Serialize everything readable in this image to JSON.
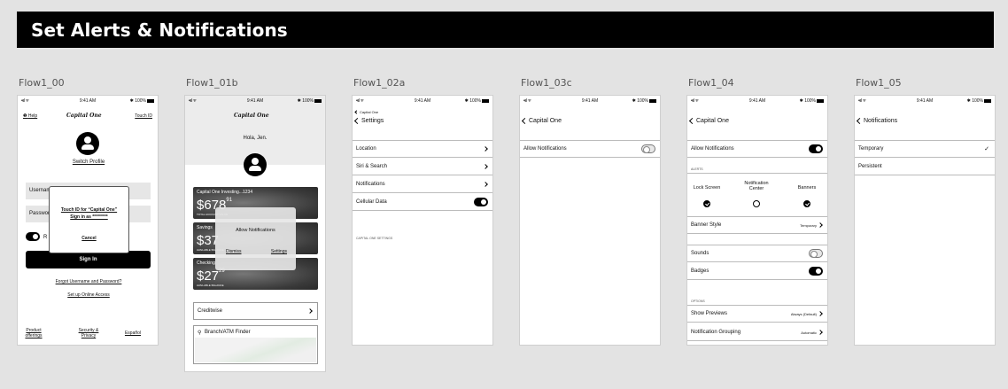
{
  "page_title": "Set Alerts & Notifications",
  "status_bar": {
    "signal": "•ııl ᯤ",
    "time": "9:41 AM",
    "battery": "✱ 100%"
  },
  "flow_00": {
    "label": "Flow1_00",
    "help": "Help",
    "logo": "Capital One",
    "touch_id": "Touch ID",
    "switch_profile": "Switch Profile",
    "username_placeholder": "Username",
    "password_placeholder": "Password",
    "remember": "R",
    "dialog_line1": "Touch ID for “Capital One”",
    "dialog_line2": "Sign in as *********",
    "dialog_cancel": "Cancel",
    "sign_in": "Sign In",
    "forgot": "Forgot Username and Password?",
    "setup": "Set up Online Access",
    "footer": [
      "Product offerings",
      "Security & Privacy",
      "Español"
    ]
  },
  "flow_01b": {
    "label": "Flow1_01b",
    "logo": "Capital One",
    "greeting": "Hola, Jen.",
    "cards": [
      {
        "title": "Capital One Investing...1234",
        "dollars": "678",
        "cents": "91",
        "sub": "TOTAL ACCOUNT VALUE"
      },
      {
        "title": "Savings",
        "dollars": "37",
        "cents": "",
        "sub": "AVAILABLE BALANCE"
      },
      {
        "title": "Checking",
        "dollars": "27",
        "cents": "29",
        "sub": "AVAILABLE BALANCE"
      }
    ],
    "overlay_title": "Allow Notifications",
    "overlay_dismiss": "Dismiss",
    "overlay_settings": "Settings",
    "creditwise": "Creditwise",
    "branch_finder": "Branch/ATM Finder"
  },
  "flow_02a": {
    "label": "Flow1_02a",
    "back_small": "Capital One",
    "nav_title": "Settings",
    "rows": [
      "Location",
      "Siri & Search",
      "Notifications",
      "Cellular Data"
    ],
    "section": "CAPITAL ONE SETTINGS"
  },
  "flow_03c": {
    "label": "Flow1_03c",
    "nav_title": "Capital One",
    "row": "Allow Notifications"
  },
  "flow_04": {
    "label": "Flow1_04",
    "nav_title": "Capital One",
    "allow": "Allow Notifications",
    "alerts_section": "ALERTS",
    "columns": [
      "Lock Screen",
      "Notification Center",
      "Banners"
    ],
    "banner_style": "Banner Style",
    "banner_style_value": "Temporary",
    "sounds": "Sounds",
    "badges": "Badges",
    "options_section": "OPTIONS",
    "show_previews": "Show Previews",
    "show_previews_value": "Always (Default)",
    "grouping": "Notification Grouping",
    "grouping_value": "Automatic"
  },
  "flow_05": {
    "label": "Flow1_05",
    "nav_title": "Notifications",
    "rows": [
      "Temporary",
      "Persistent"
    ],
    "selected_mark": "✓"
  }
}
